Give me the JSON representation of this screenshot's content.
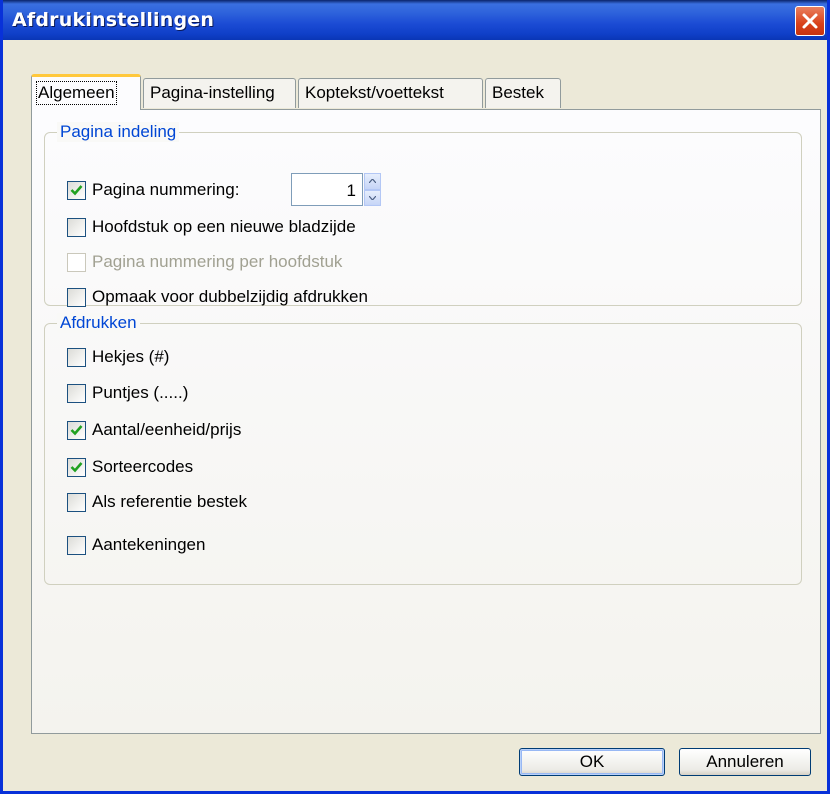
{
  "window": {
    "title": "Afdrukinstellingen"
  },
  "tabs": [
    {
      "label": "Algemeen",
      "active": true
    },
    {
      "label": "Pagina-instelling",
      "active": false
    },
    {
      "label": "Koptekst/voettekst",
      "active": false
    },
    {
      "label": "Bestek",
      "active": false
    }
  ],
  "page_layout": {
    "title": "Pagina indeling",
    "page_numbering": {
      "label": "Pagina nummering:",
      "checked": true,
      "value": "1"
    },
    "chapter_new_page": {
      "label": "Hoofdstuk op een nieuwe bladzijde",
      "checked": false
    },
    "numbering_per_chapter": {
      "label": "Pagina nummering per hoofdstuk",
      "checked": false,
      "disabled": true
    },
    "duplex": {
      "label": "Opmaak voor dubbelzijdig afdrukken",
      "checked": false
    }
  },
  "print": {
    "title": "Afdrukken",
    "options": [
      {
        "label": "Hekjes (#)",
        "checked": false
      },
      {
        "label": "Puntjes (.....)",
        "checked": false
      },
      {
        "label": "Aantal/eenheid/prijs",
        "checked": true
      },
      {
        "label": "Sorteercodes",
        "checked": true
      },
      {
        "label": "Als referentie bestek",
        "checked": false
      },
      {
        "label": "Aantekeningen",
        "checked": false
      }
    ]
  },
  "buttons": {
    "ok": "OK",
    "cancel": "Annuleren"
  },
  "colors": {
    "title_bar": "#0a36b5",
    "group_title": "#0046d5",
    "check": "#21a121",
    "close": "#d9411b"
  }
}
